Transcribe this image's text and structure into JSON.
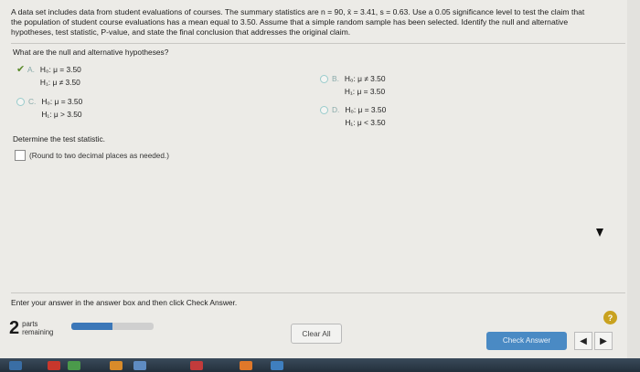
{
  "question": {
    "line1": "A data set includes data from student evaluations of courses. The summary statistics are n = 90, x̄ = 3.41, s = 0.63. Use a 0.05 significance level to test the claim that",
    "line2": "the population of student course evaluations has a mean equal to 3.50. Assume that a simple random sample has been selected. Identify the null and alternative",
    "line3": "hypotheses, test statistic, P-value, and state the final conclusion that addresses the original claim."
  },
  "prompt": "What are the null and alternative hypotheses?",
  "choices": [
    {
      "letter": "A.",
      "h0": "H₀: μ = 3.50",
      "h1": "H₁: μ ≠ 3.50",
      "selected": true
    },
    {
      "letter": "B.",
      "h0": "H₀: μ ≠ 3.50",
      "h1": "H₁: μ = 3.50",
      "selected": false
    },
    {
      "letter": "C.",
      "h0": "H₀: μ = 3.50",
      "h1": "H₁: μ > 3.50",
      "selected": false
    },
    {
      "letter": "D.",
      "h0": "H₀: μ = 3.50",
      "h1": "H₁: μ < 3.50",
      "selected": false
    }
  ],
  "test_stat_label": "Determine the test statistic.",
  "answer_hint": "(Round to two decimal places as needed.)",
  "answer_value": "",
  "footer_instruction": "Enter your answer in the answer box and then click Check Answer.",
  "parts": {
    "count": "2",
    "label_line1": "parts",
    "label_line2": "remaining",
    "progress_fraction": 0.5
  },
  "buttons": {
    "clear": "Clear All",
    "check": "Check Answer",
    "prev": "◀",
    "next": "▶",
    "help": "?"
  },
  "colors": {
    "accent": "#4a8ac4",
    "progress": "#3b77b8",
    "check_mark": "#5a8a2a",
    "help": "#c9a21f"
  },
  "icons": {
    "selected": "check-icon",
    "unselected": "radio-icon"
  }
}
